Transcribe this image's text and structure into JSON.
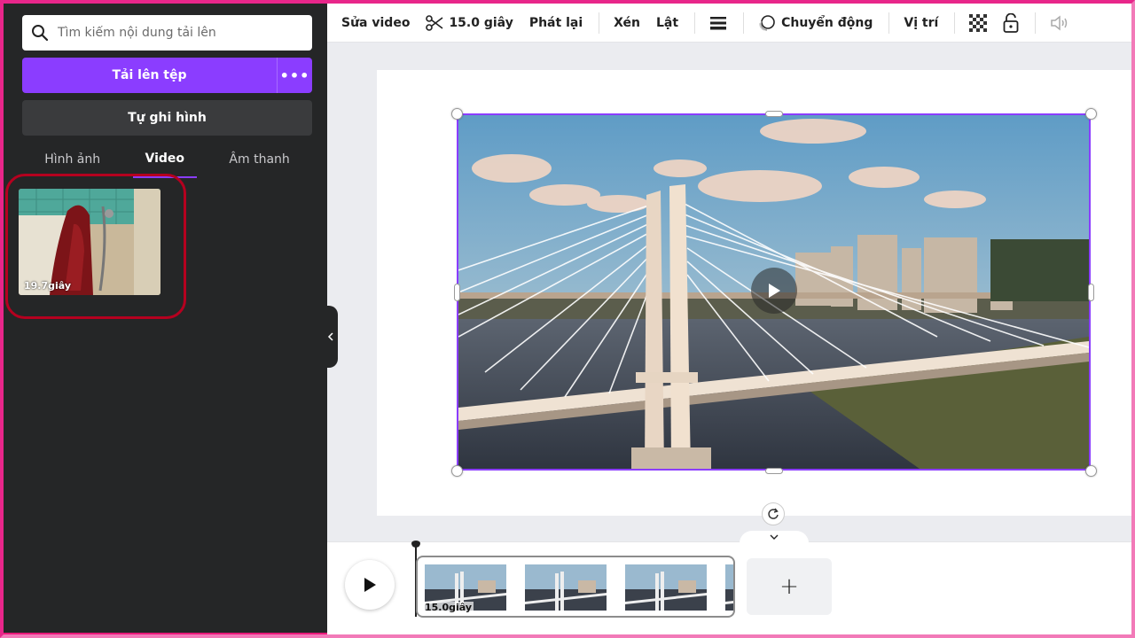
{
  "sidebar": {
    "search": {
      "placeholder": "Tìm kiếm nội dung tải lên"
    },
    "upload_label": "Tải lên tệp",
    "upload_more_label": "•••",
    "record_label": "Tự ghi hình",
    "tabs": [
      {
        "label": "Hình ảnh",
        "active": false
      },
      {
        "label": "Video",
        "active": true
      },
      {
        "label": "Âm thanh",
        "active": false
      }
    ],
    "uploads": [
      {
        "duration": "19.7giây"
      }
    ]
  },
  "toolbar": {
    "edit_video": "Sửa video",
    "trim_duration": "15.0 giây",
    "playback": "Phát lại",
    "crop": "Xén",
    "flip": "Lật",
    "animate": "Chuyển động",
    "position": "Vị trí"
  },
  "timeline": {
    "clip_duration": "15.0giây",
    "add_label": "+"
  },
  "colors": {
    "accent": "#8b3dff",
    "sidebar_bg": "#252627",
    "highlight_ring": "#b5001f",
    "frame_border": "#e8268a"
  }
}
